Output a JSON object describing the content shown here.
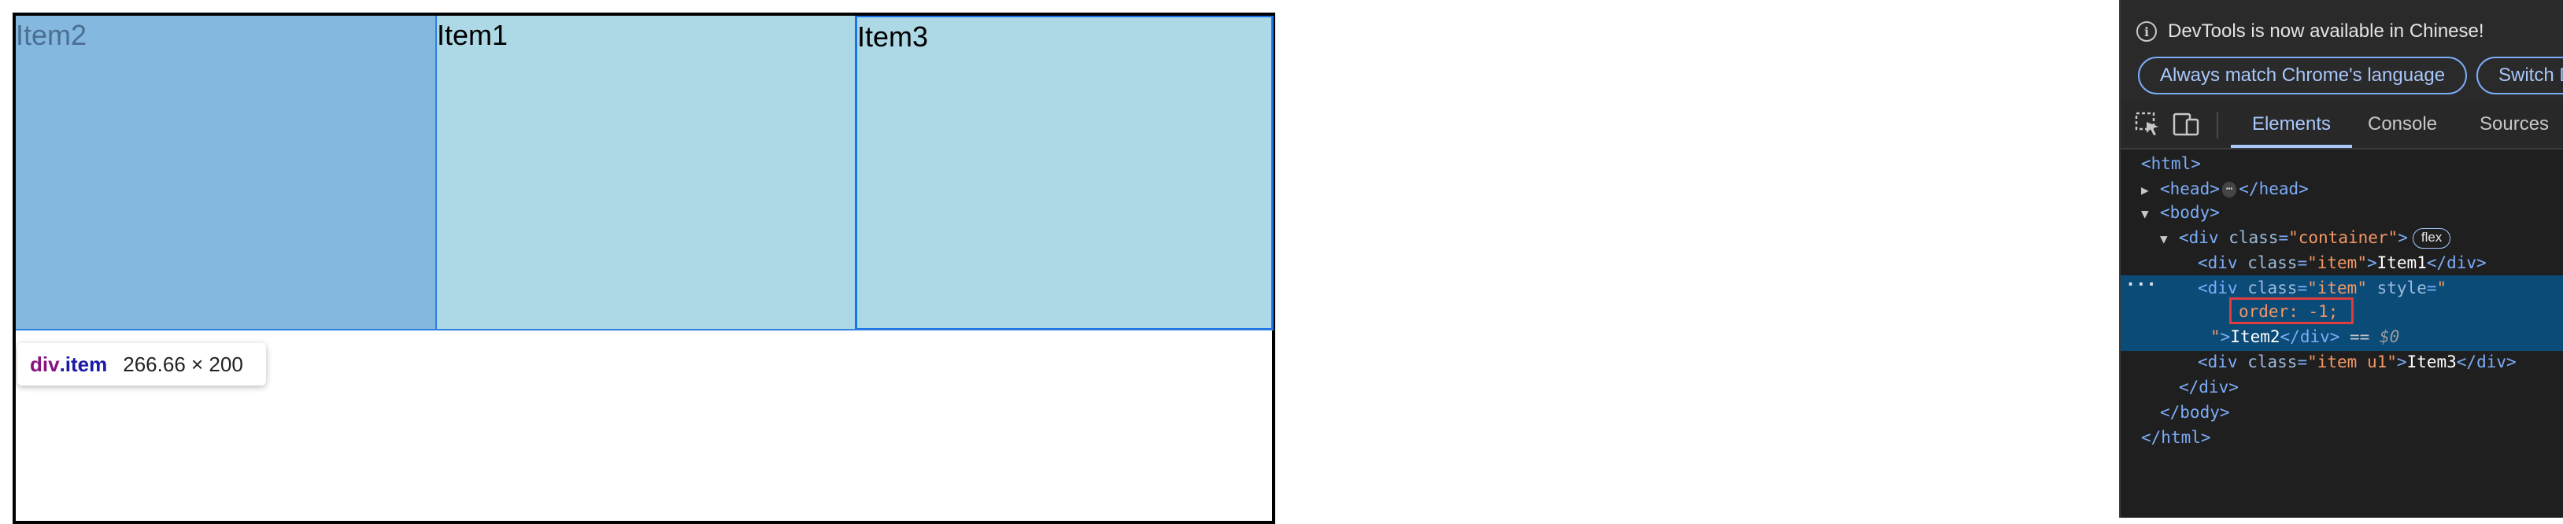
{
  "page": {
    "items": [
      {
        "label": "Item2",
        "bg": "#84b8df"
      },
      {
        "label": "Item1",
        "bg": "#add8e6"
      },
      {
        "label": "Item3",
        "bg": "#add8e6"
      }
    ],
    "tooltip": {
      "tag": "div",
      "class": ".item",
      "dims": "266.66 × 200"
    }
  },
  "devtools": {
    "infobar": {
      "message": "DevTools is now available in Chinese!",
      "button_match": "Always match Chrome's language",
      "button_switch": "Switch D"
    },
    "tabs": [
      "Elements",
      "Console",
      "Sources"
    ],
    "active_tab": "Elements",
    "dom": {
      "html_open": "<html>",
      "head_open": "<head>",
      "head_ellipsis": "⋯",
      "head_close": "</head>",
      "body_open": "<body>",
      "container_tag": "<div",
      "container_attr": "class",
      "container_value": "\"container\"",
      "container_close": ">",
      "flex_badge": "flex",
      "item1_open": "<div",
      "item1_attr": "class",
      "item1_value": "\"item\"",
      "item1_text": "Item1",
      "item1_close": "</div>",
      "item2_open": "<div",
      "item2_attr1": "class",
      "item2_value1": "\"item\"",
      "item2_attr2": "style",
      "item2_value2_start": "\"",
      "item2_style": "order: -1;",
      "item2_value2_end": "\"",
      "item2_text": "Item2",
      "item2_close": "</div>",
      "item2_eq": " == ",
      "item2_dollar": "$0",
      "item3_open": "<div",
      "item3_attr": "class",
      "item3_value": "\"item u1\"",
      "item3_text": "Item3",
      "item3_close": "</div>",
      "div_close": "</div>",
      "body_close": "</body>",
      "html_close": "</html>"
    }
  },
  "colors": {
    "accent": "#a8c7fa",
    "selected_row": "#0b4b78",
    "highlight_box": "#e03c3c"
  }
}
